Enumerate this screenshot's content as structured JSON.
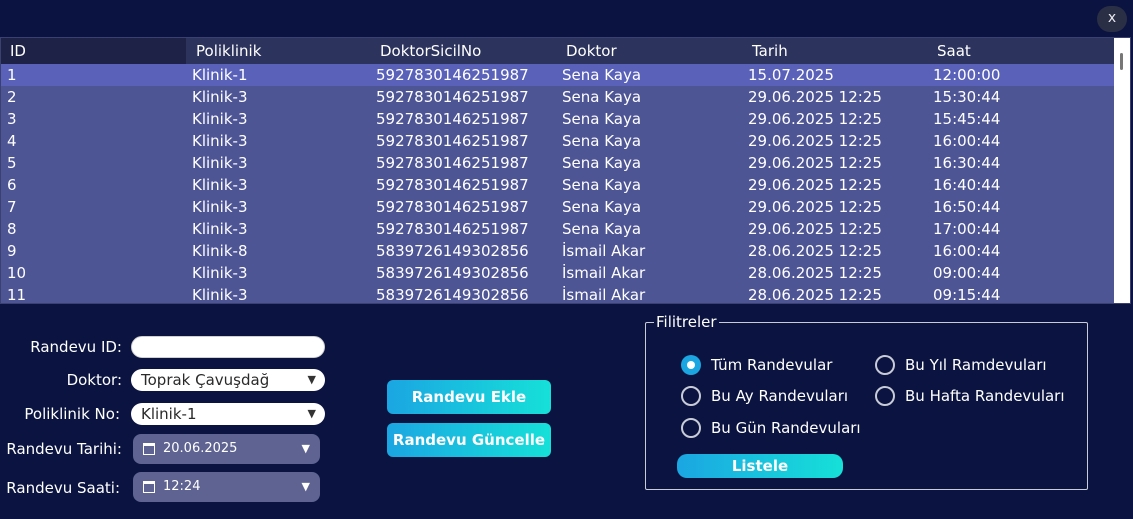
{
  "window": {
    "close_label": "x"
  },
  "grid": {
    "columns": [
      "ID",
      "Poliklinik",
      "DoktorSicilNo",
      "Doktor",
      "Tarih",
      "Saat"
    ],
    "rows": [
      [
        "1",
        "Klinik-1",
        "5927830146251987",
        "Sena Kaya",
        "15.07.2025",
        "12:00:00"
      ],
      [
        "2",
        "Klinik-3",
        "5927830146251987",
        "Sena Kaya",
        "29.06.2025 12:25",
        "15:30:44"
      ],
      [
        "3",
        "Klinik-3",
        "5927830146251987",
        "Sena Kaya",
        "29.06.2025 12:25",
        "15:45:44"
      ],
      [
        "4",
        "Klinik-3",
        "5927830146251987",
        "Sena Kaya",
        "29.06.2025 12:25",
        "16:00:44"
      ],
      [
        "5",
        "Klinik-3",
        "5927830146251987",
        "Sena Kaya",
        "29.06.2025 12:25",
        "16:30:44"
      ],
      [
        "6",
        "Klinik-3",
        "5927830146251987",
        "Sena Kaya",
        "29.06.2025 12:25",
        "16:40:44"
      ],
      [
        "7",
        "Klinik-3",
        "5927830146251987",
        "Sena Kaya",
        "29.06.2025 12:25",
        "16:50:44"
      ],
      [
        "8",
        "Klinik-3",
        "5927830146251987",
        "Sena Kaya",
        "29.06.2025 12:25",
        "17:00:44"
      ],
      [
        "9",
        "Klinik-8",
        "5839726149302856",
        "İsmail Akar",
        "28.06.2025 12:25",
        "16:00:44"
      ],
      [
        "10",
        "Klinik-3",
        "5839726149302856",
        "İsmail Akar",
        "28.06.2025 12:25",
        "09:00:44"
      ],
      [
        "11",
        "Klinik-3",
        "5839726149302856",
        "İsmail Akar",
        "28.06.2025 12:25",
        "09:15:44"
      ]
    ],
    "selected_row": 0
  },
  "form": {
    "randevu_id_label": "Randevu ID:",
    "randevu_id_value": "",
    "doktor_label": "Doktor:",
    "doktor_value": "Toprak Çavuşdağ",
    "poliklinik_label": "Poliklinik No:",
    "poliklinik_value": "Klinik-1",
    "tarih_label": "Randevu Tarihi:",
    "tarih_value": "20.06.2025",
    "saat_label": "Randevu Saati:",
    "saat_value": "12:24"
  },
  "actions": {
    "add_label": "Randevu Ekle",
    "update_label": "Randevu Güncelle"
  },
  "filters": {
    "title": "Filitreler",
    "options": [
      "Tüm Randevular",
      "Bu Ay Randevuları",
      "Bu Gün Randevuları",
      "Bu Yıl Ramdevuları",
      "Bu Hafta Randevuları"
    ],
    "selected": "Tüm Randevular",
    "list_label": "Listele"
  },
  "colors": {
    "background": "#0b1440",
    "grid_body": "#4e5594",
    "grid_header": "#2c335c",
    "selected_row": "#5a61b8",
    "accent_start": "#1ba6e2",
    "accent_end": "#16e0d8"
  },
  "icons": {
    "close": "close-icon",
    "calendar": "calendar-icon",
    "dropdown": "chevron-down-icon"
  }
}
